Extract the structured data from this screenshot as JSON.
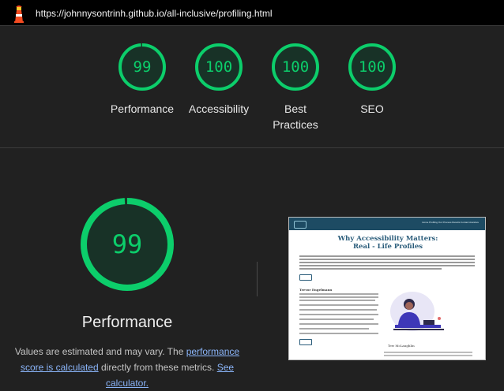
{
  "address_bar": {
    "url": "https://johnnysontrinh.github.io/all-inclusive/profiling.html",
    "logo_icon": "lighthouse-icon"
  },
  "summary_gauges": [
    {
      "score": "99",
      "label": "Performance",
      "value": 0.99
    },
    {
      "score": "100",
      "label": "Accessibility",
      "value": 1.0
    },
    {
      "score": "100",
      "label_line1": "Best",
      "label_line2": "Practices",
      "value": 1.0
    },
    {
      "score": "100",
      "label": "SEO",
      "value": 1.0
    }
  ],
  "performance": {
    "score": "99",
    "value": 0.99,
    "title": "Performance",
    "desc_prefix": "Values are estimated and may vary. The ",
    "desc_link1": "performance score is calculated",
    "desc_middle": " directly from these metrics. ",
    "desc_link2": "See calculator.",
    "screenshot": {
      "heading_line1": "Why Accessibility Matters:",
      "heading_line2": "Real - Life Profiles",
      "nav_links": "Home  Profiling  Our Process  Results  Contact  Assistive",
      "section_heading": "Trevor Engelmann",
      "person_name": "Tew McLaughlin"
    }
  },
  "colors": {
    "pass": "#0cce6b",
    "background": "#212121",
    "link": "#8ab4f8"
  }
}
